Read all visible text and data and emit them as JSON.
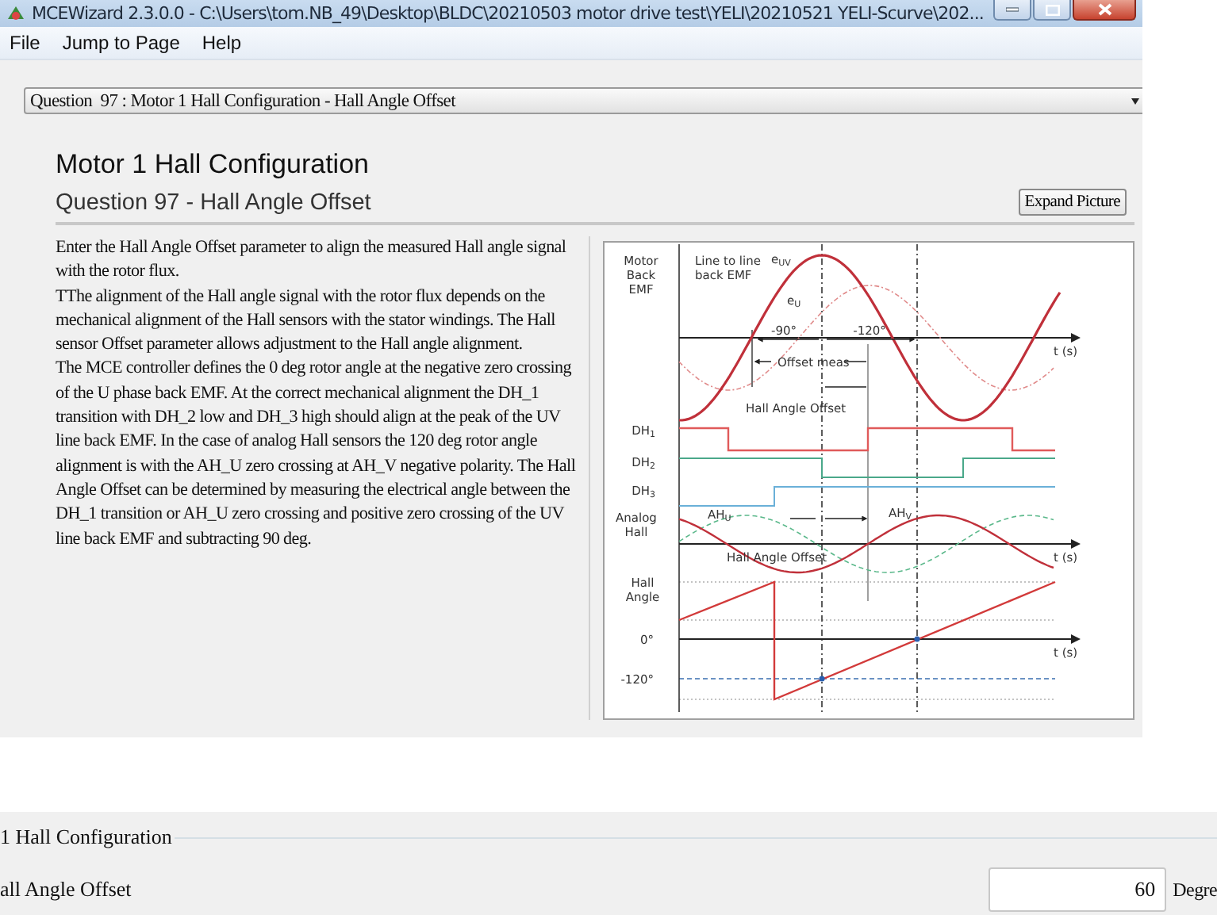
{
  "window": {
    "title": "MCEWizard 2.3.0.0  - C:\\Users\\tom.NB_49\\Desktop\\BLDC\\20210503 motor drive test\\YELI\\20210521 YELI-Scurve\\202..."
  },
  "menu": [
    {
      "label": "File"
    },
    {
      "label": "Jump to Page"
    },
    {
      "label": "Help"
    }
  ],
  "question_selector": {
    "value": "Question  97 : Motor 1 Hall Configuration - Hall Angle Offset"
  },
  "heading": "Motor 1 Hall Configuration",
  "subheading": "Question 97 - Hall Angle Offset",
  "expand_button": "Expand Picture",
  "description": [
    "Enter the Hall Angle Offset parameter to align the measured Hall angle signal with the rotor flux.",
    "TThe alignment of the Hall angle signal with the rotor flux depends on the mechanical alignment of the Hall sensors with the stator windings. The Hall sensor Offset parameter allows adjustment to the Hall angle alignment.",
    "The MCE controller defines the 0 deg rotor angle at the negative zero crossing of the U phase back EMF. At the correct mechanical alignment the DH_1 transition with DH_2 low and DH_3 high should align at the peak of the UV line back EMF. In the case of analog Hall sensors the 120 deg rotor angle alignment is with the AH_U zero crossing at AH_V negative polarity. The Hall Angle Offset can be determined by measuring the electrical angle between the DH_1 transition or AH_U zero crossing and positive zero crossing of the UV line back EMF and subtracting 90 deg."
  ],
  "diagram": {
    "back_emf_label": "Motor Back EMF",
    "line_emf_label": "Line to line back EMF",
    "uv_label": "e$_{UV}$",
    "u_label": "e$_{U}$",
    "angle_90": "-90°",
    "angle_120": "-120°",
    "offset_meas": "Offset meas",
    "hall_offset_top": "Hall  Angle  Offset",
    "dh_labels": [
      "DH$_{1}$",
      "DH$_{2}$",
      "DH$_{3}$"
    ],
    "analog_label": "Analog Hall",
    "ahu_label": "AH$_{U}$",
    "ahv_label": "AH$_{V}$",
    "hall_offset_mid": "Hall Angle Offset",
    "time_labels": [
      "t (s)",
      "t (s)",
      "t (s)"
    ],
    "hall_angle_label": "Hall Angle",
    "zero_label": "0°",
    "minus120_label": "-120°"
  },
  "settings_group": {
    "legend": "1 Hall Configuration",
    "field_label": "all Angle Offset",
    "value": "60",
    "unit": "Degre"
  }
}
